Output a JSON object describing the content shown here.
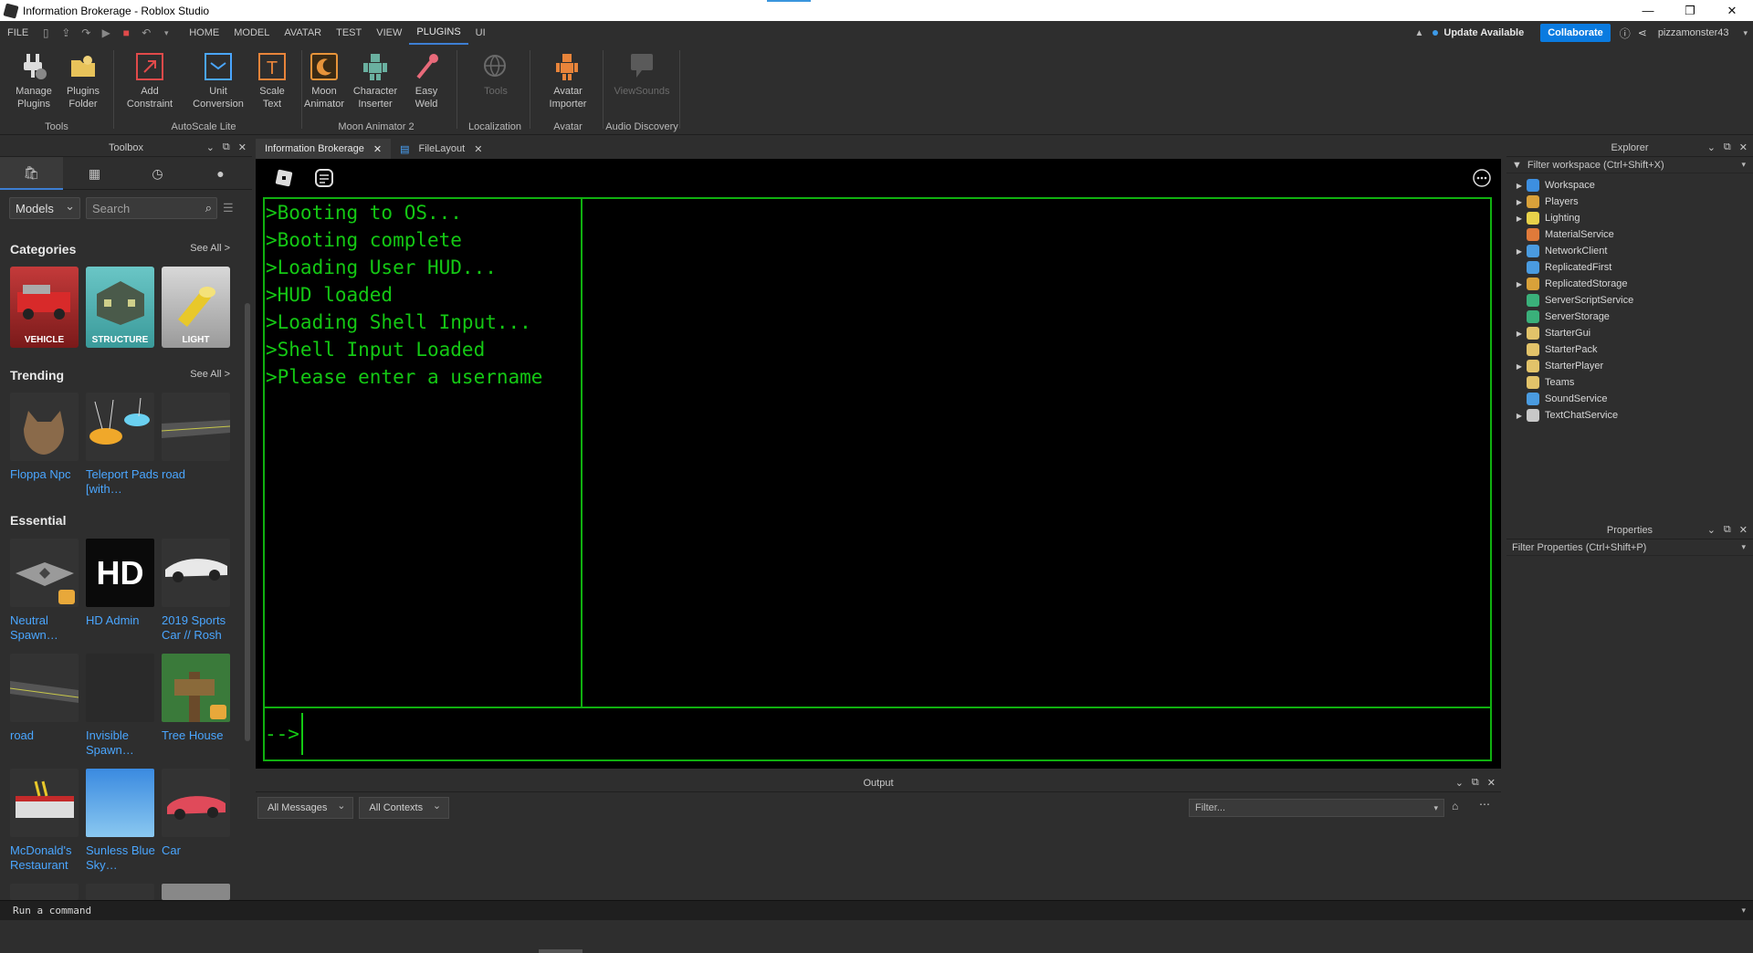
{
  "window": {
    "title": "Information Brokerage - Roblox Studio"
  },
  "menu": {
    "file": "FILE",
    "tabs": [
      "HOME",
      "MODEL",
      "AVATAR",
      "TEST",
      "VIEW",
      "PLUGINS",
      "UI"
    ],
    "active_tab": "PLUGINS",
    "update": "Update Available",
    "collaborate": "Collaborate",
    "username": "pizzamonster43"
  },
  "ribbon": {
    "tools": [
      {
        "label1": "Manage",
        "label2": "Plugins"
      },
      {
        "label1": "Plugins",
        "label2": "Folder"
      },
      {
        "label1": "Add",
        "label2": "Constraint"
      },
      {
        "label1": "Unit",
        "label2": "Conversion"
      },
      {
        "label1": "Scale",
        "label2": "Text"
      },
      {
        "label1": "Moon",
        "label2": "Animator"
      },
      {
        "label1": "Character",
        "label2": "Inserter"
      },
      {
        "label1": "Easy",
        "label2": "Weld"
      },
      {
        "label1": "Tools",
        "label2": ""
      },
      {
        "label1": "Avatar",
        "label2": "Importer"
      },
      {
        "label1": "ViewSounds",
        "label2": ""
      }
    ],
    "groups": [
      "Tools",
      "AutoScale Lite",
      "Moon Animator 2",
      "Localization",
      "Avatar",
      "Audio Discovery"
    ]
  },
  "toolbox": {
    "title": "Toolbox",
    "dropdown": "Models",
    "search_placeholder": "Search",
    "categories_title": "Categories",
    "see_all": "See All >",
    "categories": [
      "VEHICLE",
      "STRUCTURE",
      "LIGHT"
    ],
    "trending_title": "Trending",
    "trending": [
      "Floppa Npc",
      "Teleport Pads [with…",
      "road"
    ],
    "essential_title": "Essential",
    "essential": [
      "Neutral Spawn…",
      "HD Admin",
      "2019 Sports Car // Rosh",
      "road",
      "Invisible Spawn…",
      "Tree House",
      "McDonald's Restaurant",
      "Sunless Blue Sky…",
      "Car"
    ],
    "hd_text": "HD"
  },
  "doc_tabs": [
    {
      "label": "Information Brokerage",
      "active": true
    },
    {
      "label": "FileLayout",
      "active": false
    }
  ],
  "shell": {
    "lines": [
      ">Booting to OS...",
      ">Booting complete",
      ">Loading User HUD...",
      ">HUD loaded",
      ">Loading Shell Input...",
      ">Shell Input Loaded",
      ">Please enter a username"
    ],
    "prompt": "-->"
  },
  "output": {
    "title": "Output",
    "messages_filter": "All Messages",
    "contexts_filter": "All Contexts",
    "filter_placeholder": "Filter..."
  },
  "explorer": {
    "title": "Explorer",
    "filter": "Filter workspace (Ctrl+Shift+X)",
    "items": [
      {
        "name": "Workspace",
        "expandable": true,
        "icon": "globe-icon",
        "color": "#3d8fe0"
      },
      {
        "name": "Players",
        "expandable": true,
        "icon": "players-icon",
        "color": "#d9a13a"
      },
      {
        "name": "Lighting",
        "expandable": true,
        "icon": "bulb-icon",
        "color": "#e8d24a"
      },
      {
        "name": "MaterialService",
        "expandable": false,
        "icon": "material-icon",
        "color": "#e07a3a"
      },
      {
        "name": "NetworkClient",
        "expandable": true,
        "icon": "network-icon",
        "color": "#4a9be0"
      },
      {
        "name": "ReplicatedFirst",
        "expandable": false,
        "icon": "replicated-first-icon",
        "color": "#4a9be0"
      },
      {
        "name": "ReplicatedStorage",
        "expandable": true,
        "icon": "storage-icon",
        "color": "#d9a13a"
      },
      {
        "name": "ServerScriptService",
        "expandable": false,
        "icon": "script-service-icon",
        "color": "#3ab07a"
      },
      {
        "name": "ServerStorage",
        "expandable": false,
        "icon": "server-storage-icon",
        "color": "#3ab07a"
      },
      {
        "name": "StarterGui",
        "expandable": true,
        "icon": "folder-icon",
        "color": "#e2c36a"
      },
      {
        "name": "StarterPack",
        "expandable": false,
        "icon": "folder-icon",
        "color": "#e2c36a"
      },
      {
        "name": "StarterPlayer",
        "expandable": true,
        "icon": "folder-icon",
        "color": "#e2c36a"
      },
      {
        "name": "Teams",
        "expandable": false,
        "icon": "teams-icon",
        "color": "#e2c36a"
      },
      {
        "name": "SoundService",
        "expandable": false,
        "icon": "sound-icon",
        "color": "#4a9be0"
      },
      {
        "name": "TextChatService",
        "expandable": true,
        "icon": "chat-icon",
        "color": "#c8c8c8"
      }
    ]
  },
  "properties": {
    "title": "Properties",
    "filter": "Filter Properties (Ctrl+Shift+P)"
  },
  "command_bar": {
    "placeholder": "Run a command"
  }
}
